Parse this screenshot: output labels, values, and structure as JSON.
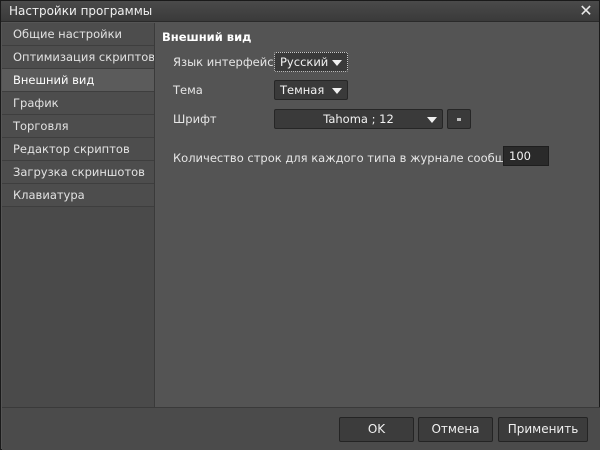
{
  "window": {
    "title": "Настройки программы"
  },
  "sidebar": {
    "items": [
      {
        "label": "Общие настройки"
      },
      {
        "label": "Оптимизация скриптов"
      },
      {
        "label": "Внешний вид"
      },
      {
        "label": "График"
      },
      {
        "label": "Торговля"
      },
      {
        "label": "Редактор скриптов"
      },
      {
        "label": "Загрузка скриншотов"
      },
      {
        "label": "Клавиатура"
      }
    ],
    "active_index": 2
  },
  "appearance": {
    "section_title": "Внешний вид",
    "language_label": "Язык интерфейса",
    "language_value": "Русский",
    "theme_label": "Тема",
    "theme_value": "Темная",
    "font_label": "Шрифт",
    "font_value": "Tahoma ; 12",
    "log_lines_label": "Количество строк для каждого типа в журнале сообщений",
    "log_lines_value": "100"
  },
  "footer": {
    "ok_label": "OK",
    "cancel_label": "Отмена",
    "apply_label": "Применить"
  },
  "colors": {
    "window_bg": "#555555",
    "sidebar_bg": "#4a4a4a",
    "input_bg": "#3a3a3a"
  }
}
